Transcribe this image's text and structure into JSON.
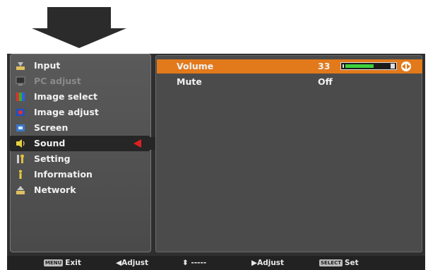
{
  "menu": {
    "items": [
      {
        "label": "Input",
        "icon": "input-icon",
        "state": "normal"
      },
      {
        "label": "PC adjust",
        "icon": "pc-adjust-icon",
        "state": "disabled"
      },
      {
        "label": "Image select",
        "icon": "image-select-icon",
        "state": "normal"
      },
      {
        "label": "Image adjust",
        "icon": "image-adjust-icon",
        "state": "normal"
      },
      {
        "label": "Screen",
        "icon": "screen-icon",
        "state": "normal"
      },
      {
        "label": "Sound",
        "icon": "speaker-icon",
        "state": "selected"
      },
      {
        "label": "Setting",
        "icon": "wrench-icon",
        "state": "normal"
      },
      {
        "label": "Information",
        "icon": "info-icon",
        "state": "normal"
      },
      {
        "label": "Network",
        "icon": "network-icon",
        "state": "normal"
      }
    ]
  },
  "sound_panel": {
    "rows": [
      {
        "label": "Volume",
        "value": "33",
        "level_percent": 66,
        "highlighted": true
      },
      {
        "label": "Mute",
        "value": "Off",
        "highlighted": false
      }
    ]
  },
  "footer": {
    "exit_key": "MENU",
    "exit_label": "Exit",
    "adjust_left_label": "Adjust",
    "updown_label": "-----",
    "adjust_right_label": "Adjust",
    "select_key": "SELECT",
    "set_label": "Set"
  },
  "colors": {
    "highlight": "#e2791b",
    "selection_arrow": "#e02020",
    "level_fill": "#3cd23c"
  }
}
